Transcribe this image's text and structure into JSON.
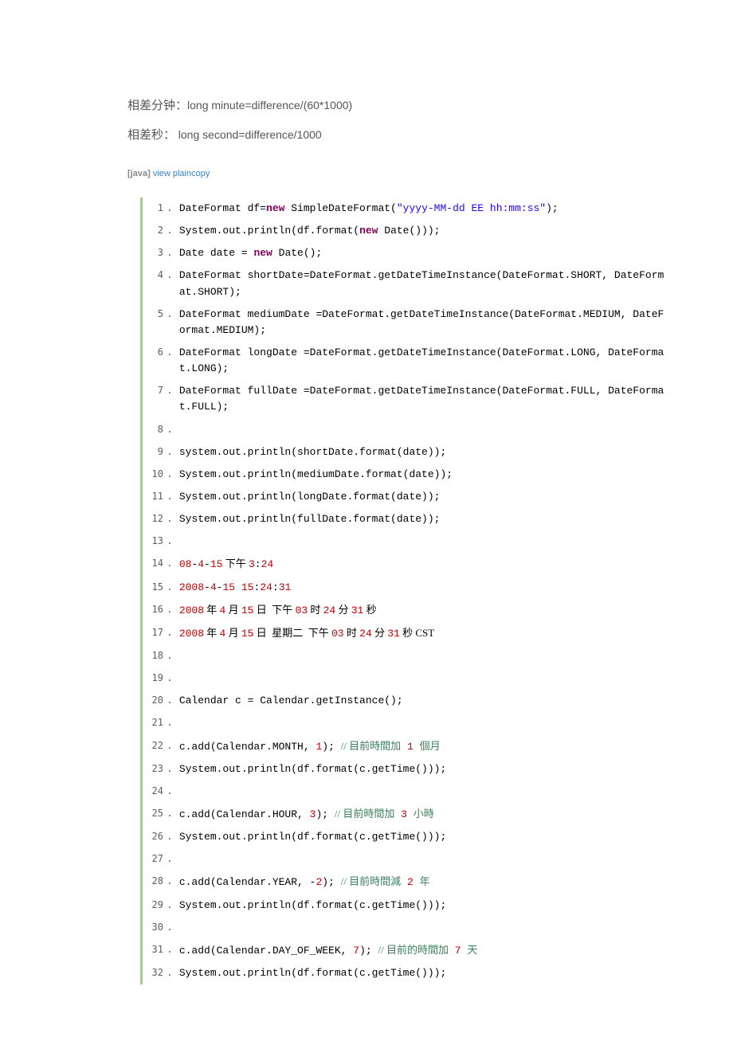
{
  "intro": {
    "line1_label": "相差分钟：",
    "line1_code": "long minute=difference/(60*1000)",
    "line2_label": "相差秒：   ",
    "line2_code": "long second=difference/1000"
  },
  "meta": {
    "lang": "[java]",
    "links": "view plaincopy"
  },
  "code": [
    {
      "n": 1,
      "t": "DateFormat df=",
      "k1": "new",
      "t2": " SimpleDateFormat(",
      "s": "\"yyyy-MM-dd EE hh:mm:ss\"",
      "t3": ");  "
    },
    {
      "n": 2,
      "t": "System.out.println(df.format(",
      "k1": "new",
      "t2": " Date()));  "
    },
    {
      "n": 3,
      "t": "Date date = ",
      "k1": "new",
      "t2": " Date();  "
    },
    {
      "n": 4,
      "t": "DateFormat shortDate=DateFormat.getDateTimeInstance(DateFormat.SHORT, DateFormat.SHORT);  "
    },
    {
      "n": 5,
      "t": "DateFormat mediumDate =DateFormat.getDateTimeInstance(DateFormat.MEDIUM, DateFormat.MEDIUM);  "
    },
    {
      "n": 6,
      "t": "DateFormat longDate =DateFormat.getDateTimeInstance(DateFormat.LONG, DateFormat.LONG);  "
    },
    {
      "n": 7,
      "t": "DateFormat fullDate =DateFormat.getDateTimeInstance(DateFormat.FULL, DateFormat.FULL);  "
    },
    {
      "n": 8,
      "t": "  "
    },
    {
      "n": 9,
      "t": "system.out.println(shortDate.format(date));  "
    },
    {
      "n": 10,
      "t": "System.out.println(mediumDate.format(date));  "
    },
    {
      "n": 11,
      "t": "System.out.println(longDate.format(date));  "
    },
    {
      "n": 12,
      "t": "System.out.println(fullDate.format(date));  "
    },
    {
      "n": 13,
      "t": "  "
    },
    {
      "n": 14,
      "r1": "08",
      "t1": "-",
      "r2": "4",
      "t2": "-",
      "r3": "15",
      "cn": " 下午 ",
      "r4": "3",
      "t3": ":",
      "r5": "24",
      "t4": "  "
    },
    {
      "n": 15,
      "r1": "2008",
      "t1": "-",
      "r2": "4",
      "t2": "-",
      "r3": "15",
      "t3": " ",
      "r4": "15",
      "t4": ":",
      "r5": "24",
      "t5": ":",
      "r6": "31",
      "t6": "  "
    },
    {
      "n": 16,
      "r1": "2008",
      "cn1": " 年 ",
      "r2": "4",
      "cn2": " 月 ",
      "r3": "15",
      "cn3": " 日  下午 ",
      "r4": "03",
      "cn4": " 时 ",
      "r5": "24",
      "cn5": " 分 ",
      "r6": "31",
      "cn6": " 秒  "
    },
    {
      "n": 17,
      "r1": "2008",
      "cn1": " 年 ",
      "r2": "4",
      "cn2": " 月 ",
      "r3": "15",
      "cn3": " 日  星期二  下午 ",
      "r4": "03",
      "cn4": " 时 ",
      "r5": "24",
      "cn5": " 分 ",
      "r6": "31",
      "cn6": " 秒 CST  "
    },
    {
      "n": 18,
      "t": "  "
    },
    {
      "n": 19,
      "t": "  "
    },
    {
      "n": 20,
      "t": "Calendar c = Calendar.getInstance();  "
    },
    {
      "n": 21,
      "t": "  "
    },
    {
      "n": 22,
      "t": "c.add(Calendar.MONTH, ",
      "r1": "1",
      "t2": "); ",
      "c1": "// 目前時間加",
      "cr": "1",
      "c2": "個月  "
    },
    {
      "n": 23,
      "t": "System.out.println(df.format(c.getTime()));  "
    },
    {
      "n": 24,
      "t": "  "
    },
    {
      "n": 25,
      "t": "c.add(Calendar.HOUR, ",
      "r1": "3",
      "t2": "); ",
      "c1": "// 目前時間加",
      "cr": "3",
      "c2": "小時  "
    },
    {
      "n": 26,
      "t": "System.out.println(df.format(c.getTime()));  "
    },
    {
      "n": 27,
      "t": "  "
    },
    {
      "n": 28,
      "t": "c.add(Calendar.YEAR, -",
      "r1": "2",
      "t2": "); ",
      "c1": "// 目前時間減",
      "cr": "2",
      "c2": "年  "
    },
    {
      "n": 29,
      "t": "System.out.println(df.format(c.getTime()));  "
    },
    {
      "n": 30,
      "t": "  "
    },
    {
      "n": 31,
      "t": "c.add(Calendar.DAY_OF_WEEK, ",
      "r1": "7",
      "t2": "); ",
      "c1": "// 目前的時間加",
      "cr": "7",
      "c2": "天  "
    },
    {
      "n": 32,
      "t": "System.out.println(df.format(c.getTime()));  "
    }
  ]
}
